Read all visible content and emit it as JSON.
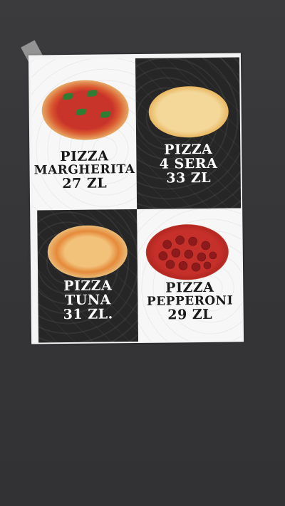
{
  "poster": {
    "items": [
      {
        "line1": "PIZZA",
        "line2": "MARGHERITA",
        "price": "27 ZL"
      },
      {
        "line1": "PIZZA",
        "line2": "4 SERA",
        "price": "33 ZL"
      },
      {
        "line1": "PIZZA",
        "line2": "TUNA",
        "price": "31 ZL."
      },
      {
        "line1": "PIZZA",
        "line2": "PEPPERONI",
        "price": "29 ZL"
      }
    ]
  },
  "colors": {
    "wall": "#3a3a3c",
    "dark_panel": "#262626",
    "light_panel": "#f7f7f7"
  }
}
